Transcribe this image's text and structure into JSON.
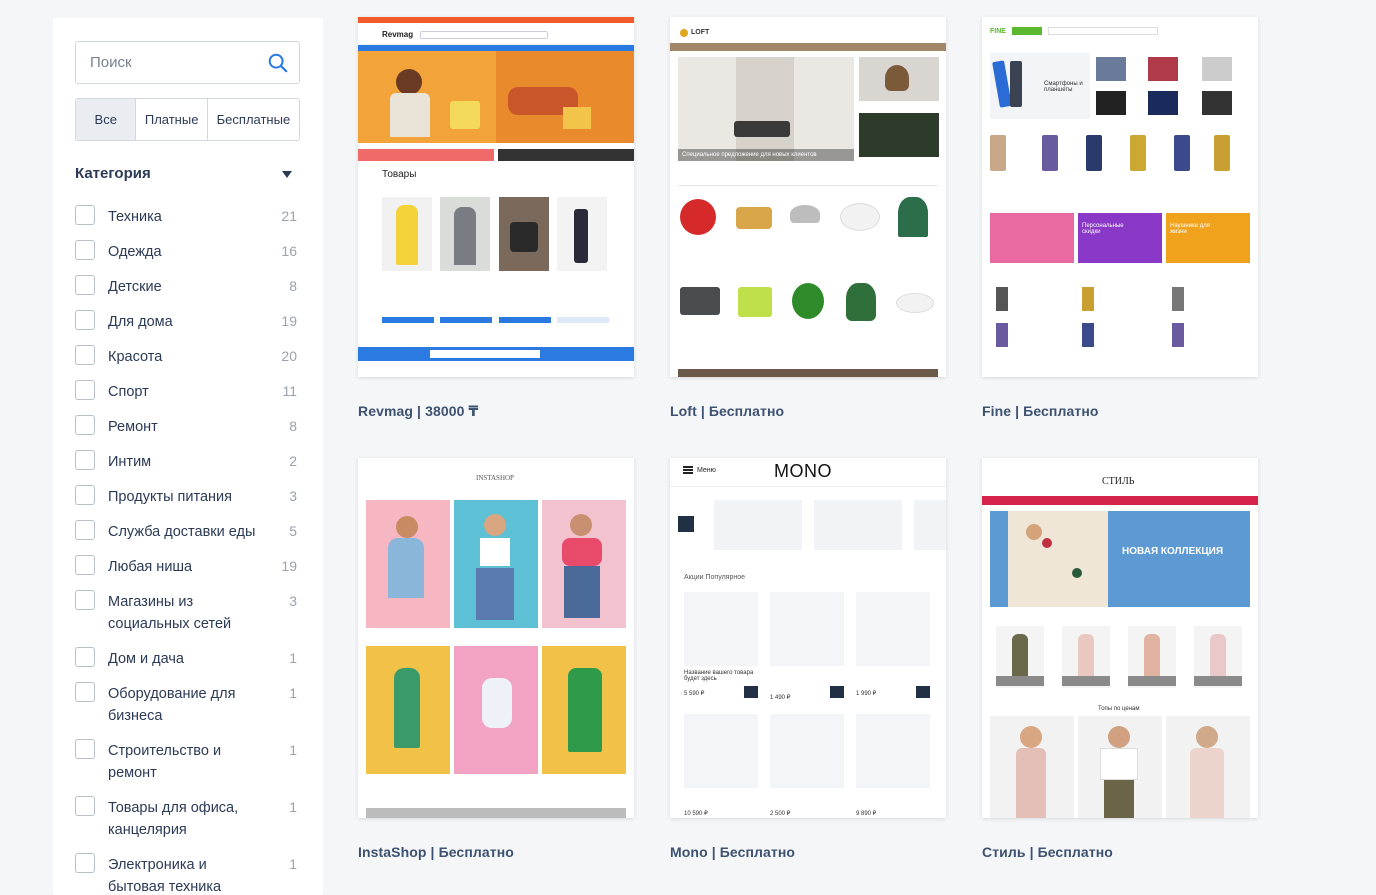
{
  "search": {
    "placeholder": "Поиск"
  },
  "filter_tabs": [
    "Все",
    "Платные",
    "Бесплатные"
  ],
  "category": {
    "title": "Категория",
    "items": [
      {
        "label": "Техника",
        "count": "21"
      },
      {
        "label": "Одежда",
        "count": "16"
      },
      {
        "label": "Детские",
        "count": "8"
      },
      {
        "label": "Для дома",
        "count": "19"
      },
      {
        "label": "Красота",
        "count": "20"
      },
      {
        "label": "Спорт",
        "count": "11"
      },
      {
        "label": "Ремонт",
        "count": "8"
      },
      {
        "label": "Интим",
        "count": "2"
      },
      {
        "label": "Продукты питания",
        "count": "3"
      },
      {
        "label": "Служба доставки еды",
        "count": "5"
      },
      {
        "label": "Любая ниша",
        "count": "19"
      },
      {
        "label": "Магазины из социальных сетей",
        "count": "3"
      },
      {
        "label": "Дом и дача",
        "count": "1"
      },
      {
        "label": "Оборудование для бизнеса",
        "count": "1"
      },
      {
        "label": "Строительство и ремонт",
        "count": "1"
      },
      {
        "label": "Товары для офиса, канцелярия",
        "count": "1"
      },
      {
        "label": "Электроника и бытовая техника",
        "count": "1"
      }
    ]
  },
  "templates": [
    {
      "caption": "Revmag | 38000 ₸",
      "logo": "Revmag",
      "section": "Товары"
    },
    {
      "caption": "Loft | Бесплатно",
      "logo": "LOFT",
      "banner": "Специальное предложение для новых клиентов"
    },
    {
      "caption": "Fine | Бесплатно",
      "logo": "FINE",
      "promo1": "Смартфоны и планшеты",
      "promo2": "Персональные скидки",
      "promo3": "Наушники для жизни"
    },
    {
      "caption": "InstaShop | Бесплатно",
      "logo": "INSTASHOP"
    },
    {
      "caption": "Mono | Бесплатно",
      "logo": "MONO",
      "menu": "Меню",
      "tabs": "Акции  Популярное",
      "price1": "5 590 ₽",
      "price2": "1 490 ₽",
      "price3": "1 990 ₽",
      "price4": "10 590 ₽",
      "price5": "2 500 ₽",
      "price6": "9 890 ₽",
      "product_name": "Название вашего товара будет здесь"
    },
    {
      "caption": "Стиль | Бесплатно",
      "logo": "СТИЛЬ",
      "banner": "НОВАЯ КОЛЛЕКЦИЯ",
      "subhead": "Топы по ценам"
    }
  ],
  "colors": {
    "accent": "#2a7ae2",
    "text": "#2b3a55",
    "muted": "#9aa2ae",
    "fine_green": "#5cb82e",
    "style_red": "#d6234c",
    "revmag_orange": "#f09a1c"
  }
}
